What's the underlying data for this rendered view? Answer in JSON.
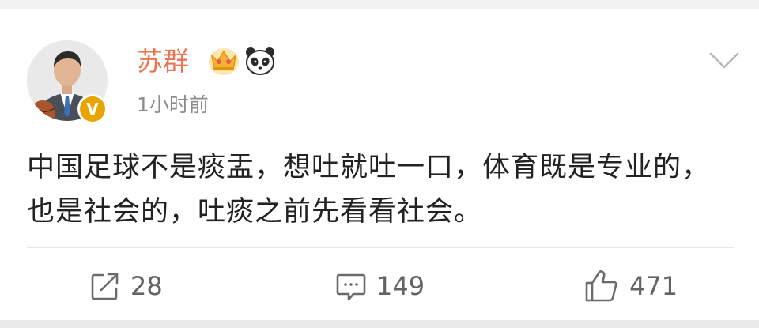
{
  "post": {
    "author": "苏群",
    "time": "1小时前",
    "verified_badge": "V",
    "text": "中国足球不是痰盂，想吐就吐一口，体育既是专业的，也是社会的，吐痰之前先看看社会。"
  },
  "actions": {
    "repost_count": "28",
    "comment_count": "149",
    "like_count": "471"
  },
  "icons": {
    "crown": "crown-icon",
    "panda": "panda-icon",
    "menu": "chevron-down-icon",
    "repost": "repost-icon",
    "comment": "comment-icon",
    "like": "thumbs-up-icon"
  },
  "colors": {
    "username": "#eb7350",
    "badge": "#e8a400",
    "meta": "#8d8d8d"
  }
}
